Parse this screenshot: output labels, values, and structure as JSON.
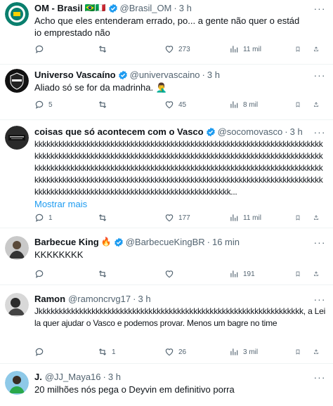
{
  "colors": {
    "accent": "#1d9bf0",
    "muted": "#536471",
    "text": "#0f1419",
    "border": "#eff3f4"
  },
  "tweets": [
    {
      "name": "OM - Brasil",
      "flags": "🇧🇷🇮🇹",
      "handle": "@Brasil_OM",
      "time": "3 h",
      "text": "Acho que eles entenderam errado, po... a gente não quer o estádio emprestado não",
      "show_more": "",
      "reply": "",
      "retweet": "",
      "like": "273",
      "views": "11 mil"
    },
    {
      "name": "Universo Vascaíno",
      "handle": "@univervascaino",
      "time": "3 h",
      "text": "Aliado só se for da madrinha. 🤦‍♂️",
      "show_more": "",
      "reply": "5",
      "retweet": "",
      "like": "45",
      "views": "8 mil"
    },
    {
      "name": "coisas que só acontecem com o Vasco",
      "handle": "@socomovasco",
      "time": "3 h",
      "text": "kkkkkkkkkkkkkkkkkkkkkkkkkkkkkkkkkkkkkkkkkkkkkkkkkkkkkkkkkkkkkkkkkkkkkkkkkkkkkkkkkkkkkkkkkkkkkkkkkkkkkkkkkkkkkkkkkkkkkkkkkkkkkkkkkkkkkkkkkkkkkkkkkkkkkkkkkkkkkkkkkkkkkkkkkkkkkkkkkkkkkkkkkkkkkkkkkkkkkkkkkkkkkkkkkkkkkkkkkkkkkkkkkkkkkkkkkkkkkkkkkkkkkkkkkkkkkkkkkkkkkkkkkkkkkkkkkkkkkkkkkkkkkkkkkkkkkkkkkkkkkkkkkkkkkkkkkkkkkkkkkkkkkkkkkkkkkkkkk...",
      "show_more": "Mostrar mais",
      "reply": "1",
      "retweet": "",
      "like": "177",
      "views": "11 mil"
    },
    {
      "name": "Barbecue King",
      "flags": "🔥",
      "handle": "@BarbecueKingBR",
      "time": "16 min",
      "text": "KKKKKKKK",
      "show_more": "",
      "reply": "",
      "retweet": "",
      "like": "",
      "views": "191"
    },
    {
      "name": "Ramon",
      "handle": "@ramoncrvg17",
      "time": "3 h",
      "text": "Jkkkkkkkkkkkkkkkkkkkkkkkkkkkkkkkkkkkkkkkkkkkkkkkkkkkkkkkkkkkkkkkkk, a Leila quer ajudar o Vasco e podemos provar. Menos um bagre no time",
      "show_more": "",
      "reply": "",
      "retweet": "1",
      "like": "26",
      "views": "3 mil"
    },
    {
      "name": "J.",
      "handle": "@JJ_Maya16",
      "time": "3 h",
      "text": "20 milhões nós pega o Deyvin em definitivo porra",
      "show_more": "",
      "reply": "",
      "retweet": "",
      "like": "",
      "views": ""
    }
  ]
}
